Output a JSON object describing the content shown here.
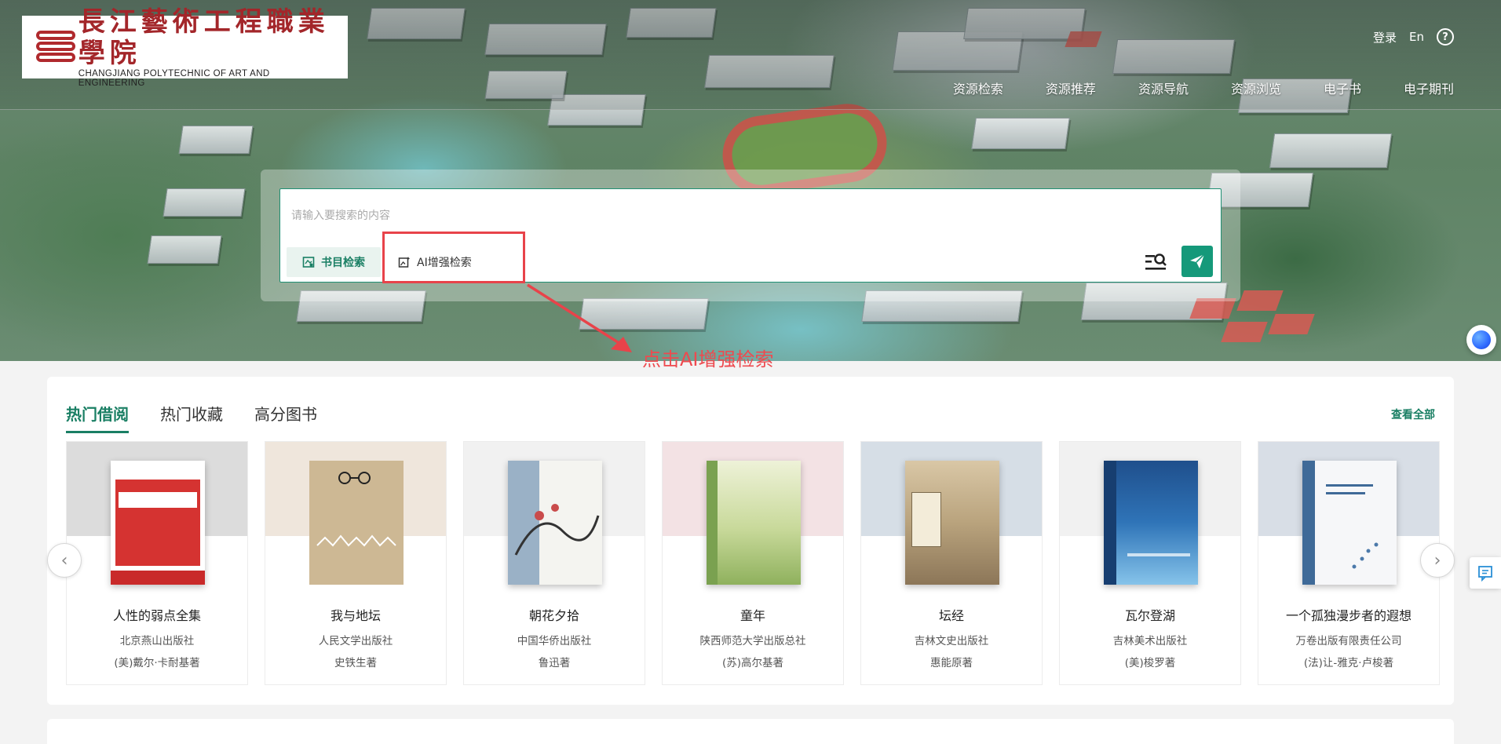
{
  "header": {
    "logo": {
      "cn_name": "長江藝術工程職業學院",
      "en_name": "CHANGJIANG POLYTECHNIC OF ART AND ENGINEERING"
    },
    "top_links": {
      "login": "登录",
      "lang": "En",
      "help": "?"
    },
    "nav": [
      "资源检索",
      "资源推荐",
      "资源导航",
      "资源浏览",
      "电子书",
      "电子期刊"
    ]
  },
  "search": {
    "placeholder": "请输入要搜索的内容",
    "value": "",
    "modes": {
      "catalog": "书目检索",
      "ai": "AI增强检索"
    },
    "active_mode": "catalog"
  },
  "annotation": {
    "text": "点击AI增强检索",
    "color": "#e8434a"
  },
  "books_section": {
    "tabs": [
      "热门借阅",
      "热门收藏",
      "高分图书"
    ],
    "active_tab": 0,
    "view_all": "查看全部",
    "books": [
      {
        "title": "人性的弱点全集",
        "publisher": "北京燕山出版社",
        "author": "(美)戴尔·卡耐基著",
        "bg": "#dcdcdc"
      },
      {
        "title": "我与地坛",
        "publisher": "人民文学出版社",
        "author": "史铁生著",
        "bg": "#efe6dc"
      },
      {
        "title": "朝花夕拾",
        "publisher": "中国华侨出版社",
        "author": "鲁迅著",
        "bg": "#f1f1f1"
      },
      {
        "title": "童年",
        "publisher": "陕西师范大学出版总社",
        "author": "(苏)高尔基著",
        "bg": "#f3e2e4"
      },
      {
        "title": "坛经",
        "publisher": "吉林文史出版社",
        "author": "惠能原著",
        "bg": "#d6dee6"
      },
      {
        "title": "瓦尔登湖",
        "publisher": "吉林美术出版社",
        "author": "(美)梭罗著",
        "bg": "#f1f1f1"
      },
      {
        "title": "一个孤独漫步者的遐想",
        "publisher": "万卷出版有限责任公司",
        "author": "(法)让-雅克·卢梭著",
        "bg": "#d8dee6"
      }
    ]
  },
  "colors": {
    "brand_green": "#1a7f64",
    "send_green": "#15997a",
    "logo_red": "#a3262a"
  }
}
